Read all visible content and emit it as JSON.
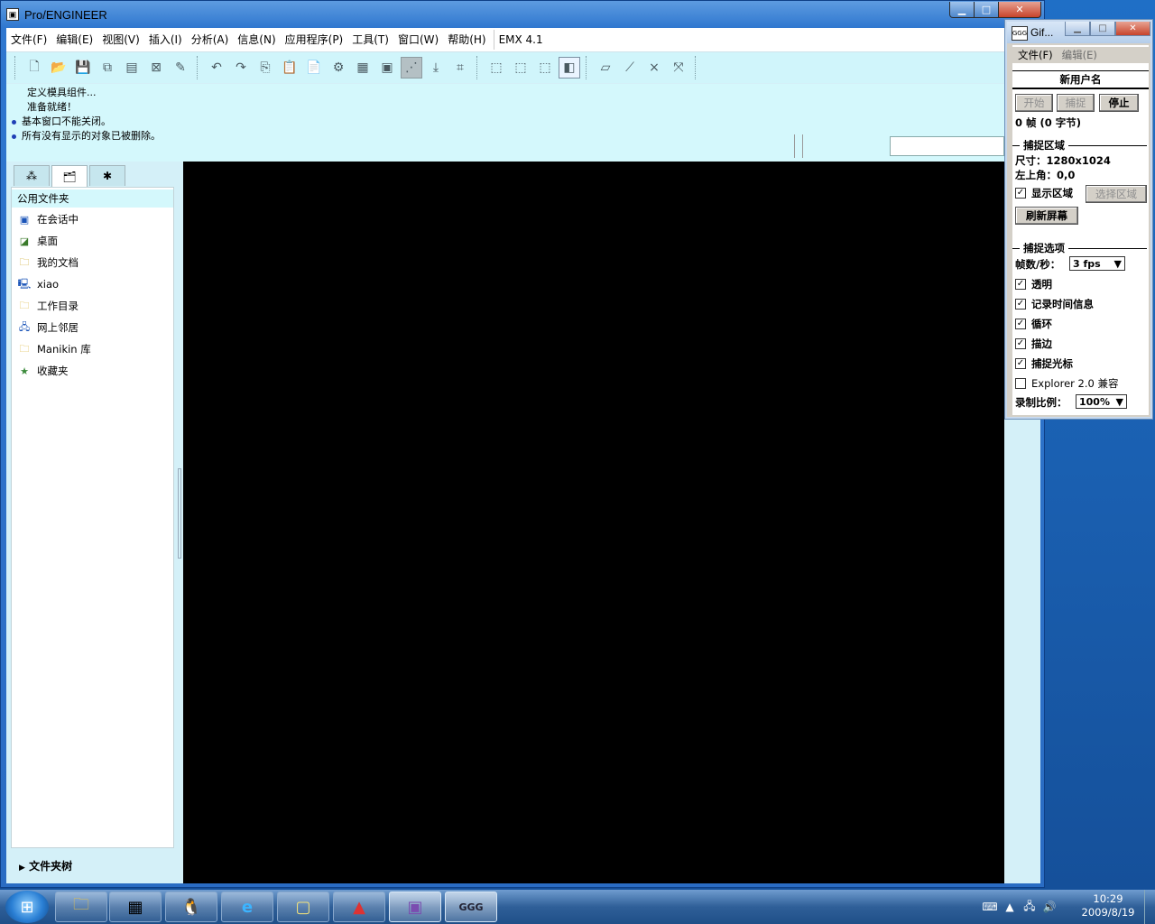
{
  "proe": {
    "title": "Pro/ENGINEER",
    "menu": [
      "文件(F)",
      "编辑(E)",
      "视图(V)",
      "插入(I)",
      "分析(A)",
      "信息(N)",
      "应用程序(P)",
      "工具(T)",
      "窗口(W)",
      "帮助(H)",
      "EMX 4.1"
    ],
    "messages": [
      "定义模具组件...",
      "准备就绪！",
      "基本窗口不能关闭。",
      "所有没有显示的对象已被删除。"
    ],
    "navigator": {
      "header": "公用文件夹",
      "items": [
        "在会话中",
        "桌面",
        "我的文档",
        "xiao",
        "工作目录",
        "网上邻居",
        "Manikin 库",
        "收藏夹"
      ],
      "folder_tree": "文件夹树"
    }
  },
  "gif": {
    "title": "Gif...",
    "menu": [
      "文件(F)",
      "编辑(E)"
    ],
    "username": "新用户名",
    "buttons": {
      "start": "开始",
      "capture": "捕捉",
      "stop": "停止"
    },
    "frames": "0 帧 (0 字节)",
    "capture_area": {
      "heading": "捕捉区域",
      "size": "尺寸：1280x1024",
      "top_left": "左上角：0,0",
      "show_area": "显示区域",
      "select_area": "选择区域",
      "refresh": "刷新屏幕"
    },
    "options": {
      "heading": "捕捉选项",
      "fps_label": "帧数/秒：",
      "fps_value": "3 fps",
      "transparent": "透明",
      "record_time": "记录时间信息",
      "loop": "循环",
      "border": "描边",
      "capture_cursor": "捕捉光标",
      "explorer": "Explorer 2.0 兼容",
      "scale_label": "录制比例：",
      "scale_value": "100%"
    }
  },
  "taskbar": {
    "time": "10:29",
    "date": "2009/8/19",
    "apps": [
      "file-explorer",
      "calculator",
      "qq",
      "internet-explorer",
      "notes",
      "autocad-2010",
      "proengineer",
      "gif-recorder"
    ]
  }
}
